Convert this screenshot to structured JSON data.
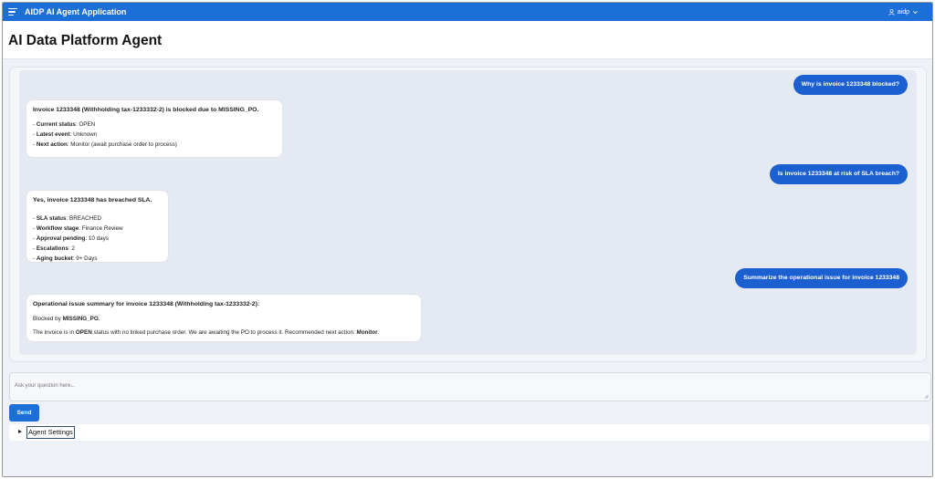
{
  "app": {
    "title": "AIDP AI Agent Application",
    "user": "aidp"
  },
  "page": {
    "title": "AI Data Platform Agent"
  },
  "colors": {
    "brand": "#1b6fd6",
    "user_bubble": "#1c5fd0"
  },
  "messages": {
    "q1": "Why is invoice 1233348 blocked?",
    "a1": {
      "head": "Invoice 1233348 (Withholding tax-1233332-2) is blocked due to MISSING_PO.",
      "l1_key": "Current status",
      "l1_val": ": OPEN",
      "l2_key": "Latest event",
      "l2_val": ": Unknown",
      "l3_key": "Next action",
      "l3_val": ": Monitor (await purchase order to process)"
    },
    "q2": "Is invoice 1233348 at risk of SLA breach?",
    "a2": {
      "head": "Yes, invoice 1233348 has breached SLA.",
      "l1_key": "SLA status",
      "l1_val": ": BREACHED",
      "l2_key": "Workflow stage",
      "l2_val": ": Finance Review",
      "l3_key": "Approval pending",
      "l3_val": ": 10 days",
      "l4_key": "Escalations",
      "l4_val": ": 2",
      "l5_key": "Aging bucket",
      "l5_val": ": 9+ Days"
    },
    "q3": "Summarize the operational issue for invoice 1233348",
    "a3": {
      "head": "Operational issue summary for invoice 1233348 (Withholding tax-1233332-2):",
      "blocked_pre": "Blocked by ",
      "blocked_val": "MISSING_PO",
      "blocked_post": ".",
      "s_pre": "The invoice is in ",
      "s_status": "OPEN",
      "s_mid": " status with no linked purchase order. We are awaiting the PO to process it. Recommended next action: ",
      "s_action": "Monitor",
      "s_end": "."
    }
  },
  "composer": {
    "placeholder": "Ask your question here..."
  },
  "send_label": "Send",
  "settings_label": "Agent Settings"
}
